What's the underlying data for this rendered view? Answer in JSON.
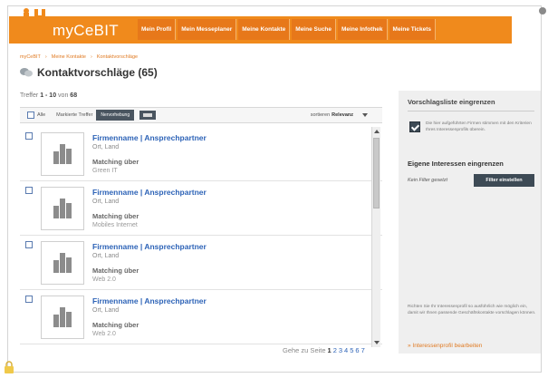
{
  "header": {
    "logo_text": "myCeBIT",
    "nav": [
      "Mein Profil",
      "Mein Messeplaner",
      "Meine Kontakte",
      "Meine Suche",
      "Meine Infothek",
      "Meine Tickets"
    ]
  },
  "breadcrumb": [
    "myCeBIT",
    "Meine Kontakte",
    "Kontaktvorschläge"
  ],
  "page": {
    "title": "Kontaktvorschläge (65)"
  },
  "results": {
    "hits_prefix": "Treffer",
    "hits_range": "1 - 10",
    "hits_of": "von",
    "hits_total": "68"
  },
  "toolbar": {
    "all_label": "Alle",
    "marked_label": "Markierte Treffer",
    "action_button": "Nervorhebung",
    "sort_label": "sortieren",
    "sort_value": "Relevanz"
  },
  "list": [
    {
      "name": "Firmenname | Ansprechpartner",
      "location": "Ort, Land",
      "match_label": "Matching über",
      "topic": "Green IT"
    },
    {
      "name": "Firmenname | Ansprechpartner",
      "location": "Ort, Land",
      "match_label": "Matching über",
      "topic": "Mobiles Internet"
    },
    {
      "name": "Firmenname | Ansprechpartner",
      "location": "Ort, Land",
      "match_label": "Matching über",
      "topic": "Web 2.0"
    },
    {
      "name": "Firmenname | Ansprechpartner",
      "location": "Ort, Land",
      "match_label": "Matching über",
      "topic": "Web 2.0"
    }
  ],
  "pager": {
    "label": "Gehe zu Seite",
    "pages": [
      "1",
      "2",
      "3",
      "4",
      "5",
      "6",
      "7"
    ],
    "current": "1"
  },
  "sidebar": {
    "heading1": "Vorschlagsliste eingrenzen",
    "checkbox_note": "Die hier aufgeführten Firmen stimmen mit den Kriterien Ihres Interessenprofils überein.",
    "heading2": "Eigene Interessen eingrenzen",
    "no_filter": "Kein Filter gesetzt",
    "filter_button": "Filter einstellen",
    "bottom_note": "Richten Sie Ihr Interessenprofil so ausführlich wie möglich ein, damit wir Ihnen passende Geschäftskontakte vorschlagen können.",
    "link": "» Interessenprofil bearbeiten"
  },
  "colors": {
    "brand_orange": "#f08a1c",
    "link_blue": "#2d63b7",
    "dark_button": "#3d4a55"
  }
}
